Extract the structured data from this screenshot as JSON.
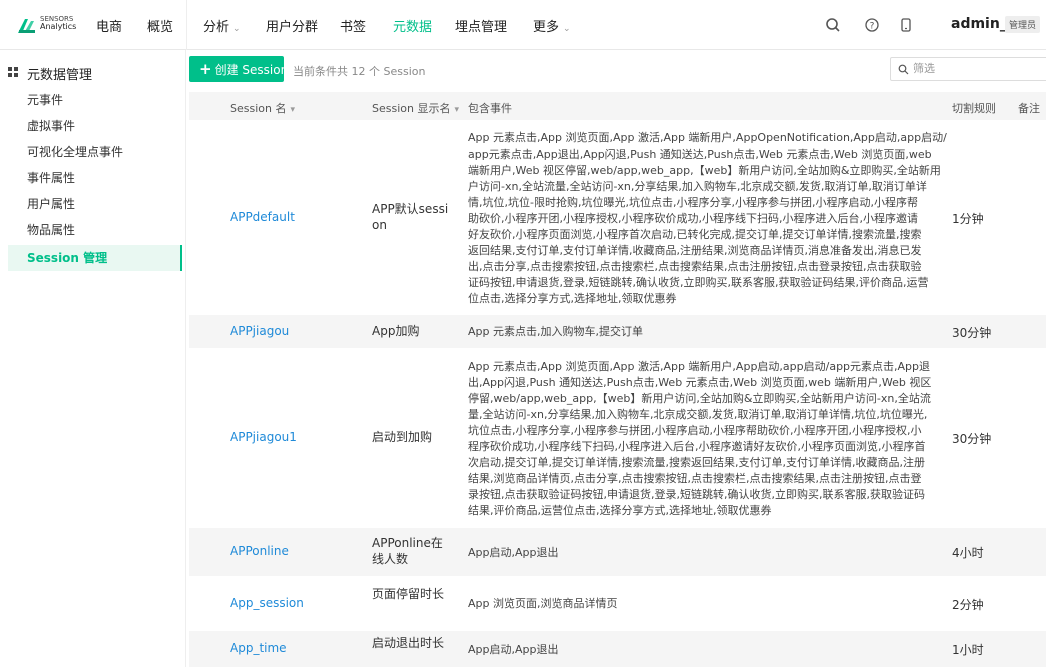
{
  "header": {
    "brand_line1": "SENSORS",
    "brand_line2": "Analytics",
    "nav": [
      {
        "label": "电商",
        "caret": false,
        "active": false
      },
      {
        "label": "概览",
        "caret": false,
        "active": false
      },
      {
        "label": "分析",
        "caret": true,
        "active": false
      },
      {
        "label": "用户分群",
        "caret": false,
        "active": false
      },
      {
        "label": "书签",
        "caret": false,
        "active": false
      },
      {
        "label": "元数据",
        "caret": false,
        "active": true
      },
      {
        "label": "埋点管理",
        "caret": false,
        "active": false
      },
      {
        "label": "更多",
        "caret": true,
        "active": false
      }
    ],
    "user": "admin_1",
    "role": "管理员",
    "icons": [
      "search-icon",
      "help-icon",
      "mobile-icon"
    ]
  },
  "sidebar": {
    "title": "元数据管理",
    "items": [
      {
        "label": "元事件",
        "active": false
      },
      {
        "label": "虚拟事件",
        "active": false
      },
      {
        "label": "可视化全埋点事件",
        "active": false
      },
      {
        "label": "事件属性",
        "active": false
      },
      {
        "label": "用户属性",
        "active": false
      },
      {
        "label": "物品属性",
        "active": false
      },
      {
        "label": "Session 管理",
        "active": true
      }
    ]
  },
  "toolbar": {
    "create_label": "创建 Session",
    "count_text": "当前条件共 12 个 Session",
    "filter_placeholder": "筛选"
  },
  "table": {
    "columns": {
      "name": "Session 名",
      "display": "Session 显示名",
      "events": "包含事件",
      "rule": "切割规则",
      "note": "备注"
    },
    "rows": [
      {
        "name": "APPdefault",
        "display_lines": [
          "APP默认sessi",
          "on"
        ],
        "event_lines": [
          "App 元素点击,App 浏览页面,App 激活,App 端新用户,AppOpenNotification,App启动,app启动/",
          "app元素点击,App退出,App闪退,Push 通知送达,Push点击,Web 元素点击,Web 浏览页面,web",
          "端新用户,Web 视区停留,web/app,web_app,【web】新用户访问,全站加购&立即购买,全站新用",
          "户访问-xn,全站流量,全站访问-xn,分享结果,加入购物车,北京成交额,发货,取消订单,取消订单详",
          "情,坑位,坑位-限时抢购,坑位曝光,坑位点击,小程序分享,小程序参与拼团,小程序启动,小程序帮",
          "助砍价,小程序开团,小程序授权,小程序砍价成功,小程序线下扫码,小程序进入后台,小程序邀请",
          "好友砍价,小程序页面浏览,小程序首次启动,已转化完成,提交订单,提交订单详情,搜索流量,搜索",
          "返回结果,支付订单,支付订单详情,收藏商品,注册结果,浏览商品详情页,消息准备发出,消息已发",
          "出,点击分享,点击搜索按钮,点击搜索栏,点击搜索结果,点击注册按钮,点击登录按钮,点击获取验",
          "证码按钮,申请退货,登录,短链跳转,确认收货,立即购买,联系客服,获取验证码结果,评价商品,运营",
          "位点击,选择分享方式,选择地址,领取优惠券"
        ],
        "rule": "1分钟"
      },
      {
        "name": "APPjiagou",
        "display_lines": [
          "App加购"
        ],
        "event_lines": [
          "App 元素点击,加入购物车,提交订单"
        ],
        "rule": "30分钟"
      },
      {
        "name": "APPjiagou1",
        "display_lines": [
          "启动到加购"
        ],
        "event_lines": [
          "App 元素点击,App 浏览页面,App 激活,App 端新用户,App启动,app启动/app元素点击,App退",
          "出,App闪退,Push 通知送达,Push点击,Web 元素点击,Web 浏览页面,web 端新用户,Web 视区",
          "停留,web/app,web_app,【web】新用户访问,全站加购&立即购买,全站新用户访问-xn,全站流",
          "量,全站访问-xn,分享结果,加入购物车,北京成交额,发货,取消订单,取消订单详情,坑位,坑位曝光,",
          "坑位点击,小程序分享,小程序参与拼团,小程序启动,小程序帮助砍价,小程序开团,小程序授权,小",
          "程序砍价成功,小程序线下扫码,小程序进入后台,小程序邀请好友砍价,小程序页面浏览,小程序首",
          "次启动,提交订单,提交订单详情,搜索流量,搜索返回结果,支付订单,支付订单详情,收藏商品,注册",
          "结果,浏览商品详情页,点击分享,点击搜索按钮,点击搜索栏,点击搜索结果,点击注册按钮,点击登",
          "录按钮,点击获取验证码按钮,申请退货,登录,短链跳转,确认收货,立即购买,联系客服,获取验证码",
          "结果,评价商品,运营位点击,选择分享方式,选择地址,领取优惠券"
        ],
        "rule": "30分钟"
      },
      {
        "name": "APPonline",
        "display_lines": [
          "APPonline在",
          "线人数"
        ],
        "event_lines": [
          "App启动,App退出"
        ],
        "rule": "4小时"
      },
      {
        "name": "App_session",
        "display_lines": [
          "页面停留时长"
        ],
        "event_lines": [
          "App 浏览页面,浏览商品详情页"
        ],
        "rule": "2分钟"
      },
      {
        "name": "App_time",
        "display_lines": [
          "启动退出时长"
        ],
        "event_lines": [
          "App启动,App退出"
        ],
        "rule": "1小时"
      }
    ]
  },
  "colors": {
    "accent": "#00bf8a",
    "link": "#1f8ad8"
  }
}
